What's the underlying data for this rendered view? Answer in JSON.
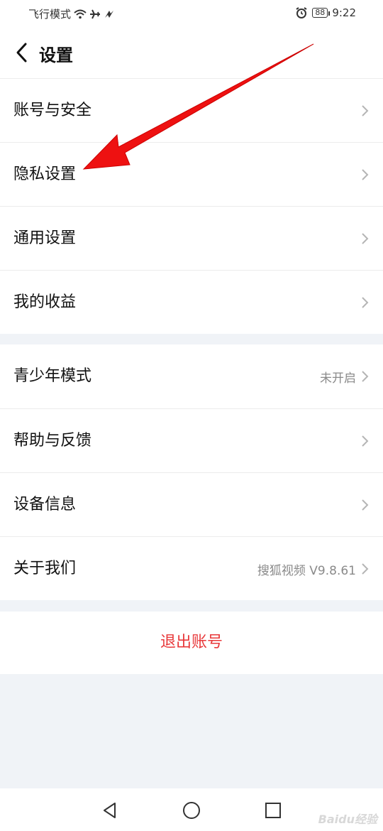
{
  "status_bar": {
    "carrier_text": "飞行模式",
    "battery": "88",
    "time": "9:22",
    "icons": [
      "wifi-icon",
      "airplane-icon",
      "data-icon",
      "alarm-icon",
      "battery-icon"
    ]
  },
  "header": {
    "title": "设置",
    "back_icon": "chevron-left-icon"
  },
  "group1": {
    "items": [
      {
        "label": "账号与安全"
      },
      {
        "label": "隐私设置"
      },
      {
        "label": "通用设置"
      },
      {
        "label": "我的收益"
      }
    ]
  },
  "group2": {
    "items": [
      {
        "label": "青少年模式",
        "value": "未开启"
      },
      {
        "label": "帮助与反馈"
      },
      {
        "label": "设备信息"
      },
      {
        "label": "关于我们",
        "value": "搜狐视频 V9.8.61"
      }
    ]
  },
  "logout": {
    "label": "退出账号",
    "color": "#e8383a"
  },
  "nav_bar": {
    "icons": [
      "back-triangle-icon",
      "home-circle-icon",
      "recents-square-icon"
    ]
  },
  "annotation": {
    "arrow_color": "#ee1111"
  },
  "watermark": {
    "text": "Baidu经验"
  },
  "colors": {
    "page_bg": "#f0f3f7",
    "card_bg": "#ffffff",
    "value_text": "#8a8a8a"
  }
}
